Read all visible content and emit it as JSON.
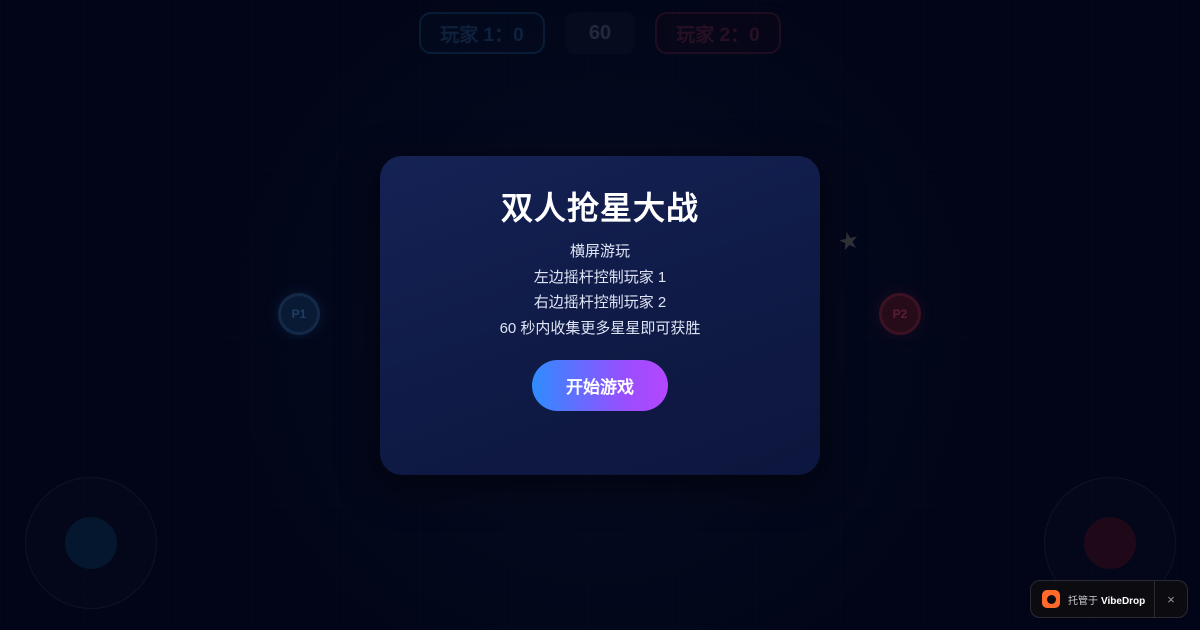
{
  "hud": {
    "p1_score": "玩家 1：0",
    "timer": "60",
    "p2_score": "玩家 2：0"
  },
  "players": {
    "p1_label": "P1",
    "p2_label": "P2"
  },
  "modal": {
    "title": "双人抢星大战",
    "lines": [
      "横屏游玩",
      "左边摇杆控制玩家 1",
      "右边摇杆控制玩家 2",
      "60 秒内收集更多星星即可获胜"
    ],
    "start_button": "开始游戏"
  },
  "badge": {
    "prefix": "托管于",
    "brand": "VibeDrop",
    "close": "×"
  },
  "icons": {
    "star": "star-icon",
    "badge_logo": "vibedrop-logo-icon",
    "close": "close-icon"
  },
  "colors": {
    "background": "#02061a",
    "player1": "#2f8cff",
    "player2": "#b0364f",
    "modal": "#152254",
    "button_start": "#2f8cff",
    "button_end": "#b447ff",
    "badge_logo": "#ff6a2a"
  }
}
